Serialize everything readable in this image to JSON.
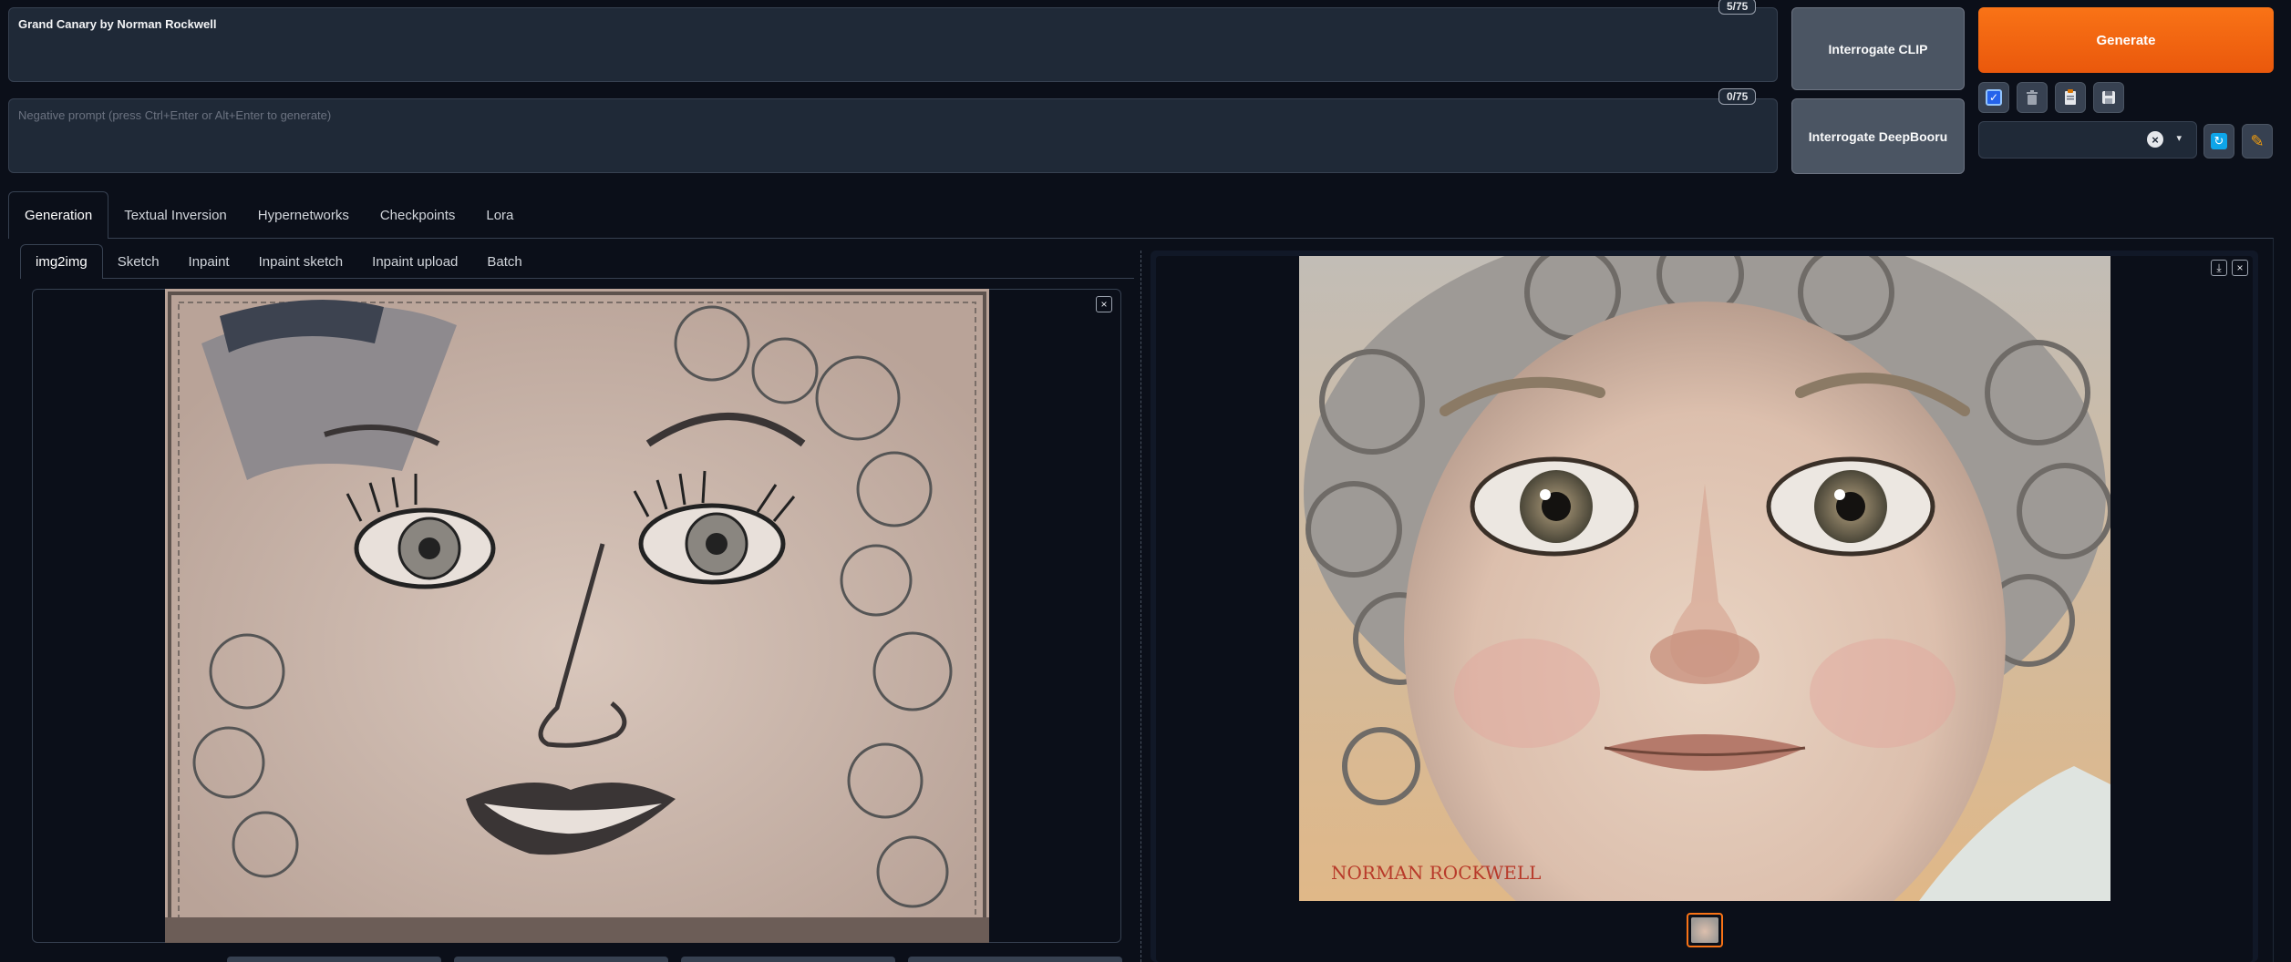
{
  "prompt": {
    "positive_text": "Grand Canary by Norman Rockwell",
    "positive_counter": "5/75",
    "negative_placeholder": "Negative prompt (press Ctrl+Enter or Alt+Enter to generate)",
    "negative_counter": "0/75"
  },
  "buttons": {
    "interrogate_clip": "Interrogate CLIP",
    "interrogate_deepbooru": "Interrogate DeepBooru",
    "generate": "Generate"
  },
  "toolbar_icons": [
    "checkbox-icon",
    "trash-icon",
    "clipboard-icon",
    "save-icon"
  ],
  "style_select": {
    "value": "",
    "clear_glyph": "×",
    "dropdown_glyph": "▾"
  },
  "main_tabs": [
    {
      "label": "Generation",
      "active": true
    },
    {
      "label": "Textual Inversion",
      "active": false
    },
    {
      "label": "Hypernetworks",
      "active": false
    },
    {
      "label": "Checkpoints",
      "active": false
    },
    {
      "label": "Lora",
      "active": false
    }
  ],
  "sub_tabs": [
    {
      "label": "img2img",
      "active": true
    },
    {
      "label": "Sketch",
      "active": false
    },
    {
      "label": "Inpaint",
      "active": false
    },
    {
      "label": "Inpaint sketch",
      "active": false
    },
    {
      "label": "Inpaint upload",
      "active": false
    },
    {
      "label": "Batch",
      "active": false
    }
  ],
  "input_image": {
    "close_glyph": "×"
  },
  "output_image": {
    "signature": "NORMAN ROCKWELL",
    "download_glyph": "⤓",
    "close_glyph": "×"
  },
  "colors": {
    "background": "#0b0f19",
    "accent": "#f97316",
    "panel": "#1f2937",
    "border": "#374151"
  }
}
